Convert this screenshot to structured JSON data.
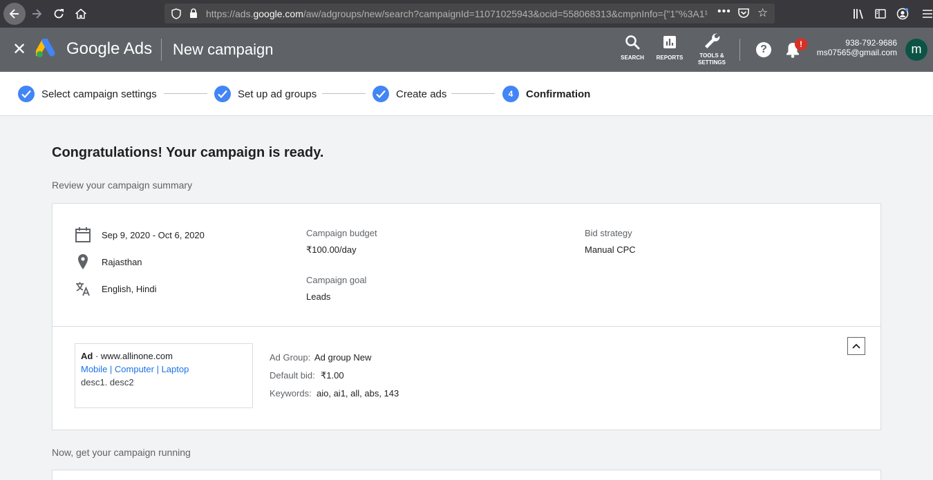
{
  "browser": {
    "url_prefix": "https://ads.",
    "url_domain": "google.com",
    "url_rest": "/aw/adgroups/new/search?campaignId=11071025943&ocid=558068313&cmpnInfo={\"1\"%3A1¹",
    "more_label": "•••"
  },
  "header": {
    "close_label": "✕",
    "brand": "Google Ads",
    "title": "New campaign",
    "tools": [
      {
        "label": "SEARCH"
      },
      {
        "label": "REPORTS"
      },
      {
        "label_line1": "TOOLS &",
        "label_line2": "SETTINGS"
      }
    ],
    "help_label": "?",
    "notification_badge": "!",
    "account_phone": "938-792-9686",
    "account_email": "ms07565@gmail.com",
    "avatar_letter": "m"
  },
  "stepper": {
    "steps": [
      {
        "label": "Select campaign settings",
        "state": "done"
      },
      {
        "label": "Set up ad groups",
        "state": "done"
      },
      {
        "label": "Create ads",
        "state": "done"
      },
      {
        "label": "Confirmation",
        "state": "active",
        "number": "4"
      }
    ]
  },
  "main": {
    "heading": "Congratulations! Your campaign is ready.",
    "subheading": "Review your campaign summary",
    "summary": {
      "dates": "Sep 9, 2020 - Oct 6, 2020",
      "location": "Rajasthan",
      "languages": "English, Hindi",
      "budget_label": "Campaign budget",
      "budget_value": "₹100.00/day",
      "goal_label": "Campaign goal",
      "goal_value": "Leads",
      "bid_label": "Bid strategy",
      "bid_value": "Manual CPC"
    },
    "ad_preview": {
      "ad_tag": "Ad",
      "url": " · www.allinone.com",
      "headline": "Mobile | Computer | Laptop",
      "description": "desc1. desc2"
    },
    "ad_group": {
      "group_label": "Ad Group:",
      "group_value": "Ad group New",
      "bid_label": "Default bid:",
      "bid_value": "₹1.00",
      "keywords_label": "Keywords:",
      "keywords_value": "aio, ai1, all, abs, 143"
    },
    "next_heading": "Now, get your campaign running"
  },
  "colors": {
    "header_bg": "#5f6368",
    "accent": "#4285f4",
    "link": "#1a73e8",
    "badge": "#d93025",
    "avatar": "#0b5345"
  }
}
